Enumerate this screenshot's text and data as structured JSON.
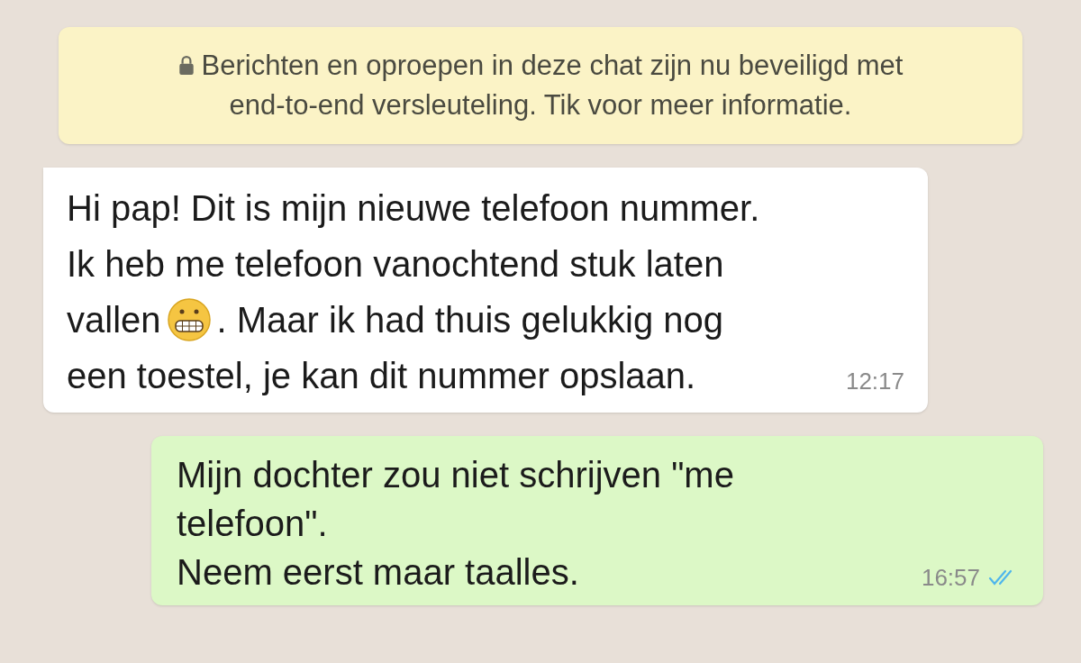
{
  "encryption_notice": {
    "lines": [
      "Berichten en oproepen in deze chat zijn nu beveiligd met",
      "end-to-end versleuteling. Tik voor meer informatie."
    ]
  },
  "messages": [
    {
      "kind": "incoming",
      "lines": [
        [
          {
            "kind": "text",
            "text": "Hi pap! Dit is mijn nieuwe telefoon nummer."
          }
        ],
        [
          {
            "kind": "text",
            "text": "Ik heb me telefoon vanochtend stuk laten"
          }
        ],
        [
          {
            "kind": "text",
            "text": "vallen"
          },
          {
            "kind": "emoji"
          },
          {
            "kind": "text",
            "text": ". Maar ik had thuis gelukkig nog"
          }
        ],
        [
          {
            "kind": "text",
            "text": "een toestel, je kan dit nummer opslaan."
          }
        ]
      ],
      "time": "12:17"
    },
    {
      "kind": "outgoing",
      "lines": [
        [
          {
            "kind": "text",
            "text": "Mijn dochter zou niet schrijven \"me"
          }
        ],
        [
          {
            "kind": "text",
            "text": "telefoon\"."
          }
        ],
        [
          {
            "kind": "text",
            "text": "Neem eerst maar taalles."
          }
        ]
      ],
      "time": "16:57",
      "read": true
    }
  ]
}
